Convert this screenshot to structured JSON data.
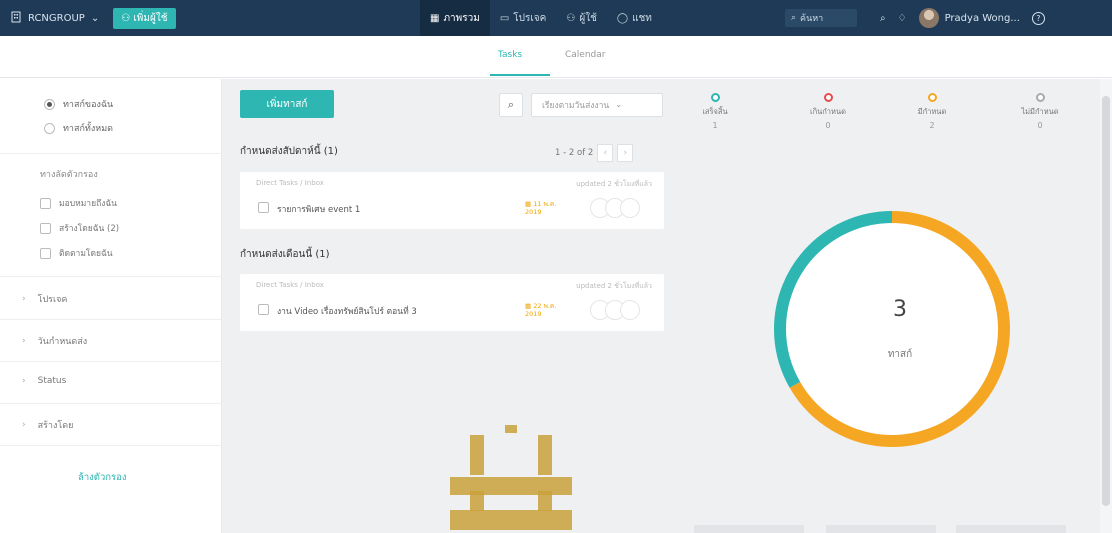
{
  "topbar": {
    "org_name": "RCNGROUP",
    "workspace": "เพิ่มผู้ใช้",
    "nav": [
      {
        "label": "ภาพรวม",
        "icon": "dashboard-icon",
        "active": true
      },
      {
        "label": "โปรเจค",
        "icon": "folder-icon",
        "active": false
      },
      {
        "label": "ผู้ใช้",
        "icon": "users-icon",
        "active": false
      },
      {
        "label": "แชท",
        "icon": "chat-icon",
        "active": false
      }
    ],
    "search_placeholder": "ค้นหา",
    "user_name": "Pradya Wong..."
  },
  "tabs": [
    {
      "label": "Tasks",
      "active": true
    },
    {
      "label": "Calendar",
      "active": false
    }
  ],
  "sidebar": {
    "view_options": [
      {
        "label": "ทาสก์ของฉัน",
        "selected": true
      },
      {
        "label": "ทาสก์ทั้งหมด",
        "selected": false
      }
    ],
    "filter_title": "ทางลัดตัวกรอง",
    "filters": [
      {
        "label": "มอบหมายถึงฉัน"
      },
      {
        "label": "สร้างโดยฉัน (2)"
      },
      {
        "label": "ติดตามโดยฉัน"
      }
    ],
    "sections": [
      "โปรเจค",
      "วันกำหนดส่ง",
      "Status",
      "สร้างโดย"
    ],
    "clear_label": "ล้างตัวกรอง"
  },
  "tasks": {
    "add_label": "เพิ่มทาสก์",
    "sort_label": "เรียงตามวันส่งงาน",
    "groups": [
      {
        "title": "กำหนดส่งสัปดาห์นี้ (1)",
        "pager": "1 - 2 of 2",
        "items": [
          {
            "crumb": "Direct Tasks / Inbox",
            "meta": "updated 2 ชั่วโมงที่แล้ว",
            "name": "รายการพิเศษ event 1",
            "due": "11 พ.ค. 2019"
          }
        ]
      },
      {
        "title": "กำหนดส่งเดือนนี้ (1)",
        "items": [
          {
            "crumb": "Direct Tasks / Inbox",
            "meta": "updated 2 ชั่วโมงที่แล้ว",
            "name": "งาน Video เรื่องทรัพย์สินโปร์ ตอนที่ 3",
            "due": "22 พ.ค. 2019"
          }
        ]
      }
    ]
  },
  "summary": {
    "stats": [
      {
        "label": "เสร็จสิ้น",
        "count": "1",
        "color": "#2db6b2"
      },
      {
        "label": "เกินกำหนด",
        "count": "0",
        "color": "#e74c4c"
      },
      {
        "label": "มีกำหนด",
        "count": "2",
        "color": "#f5a623"
      },
      {
        "label": "ไม่มีกำหนด",
        "count": "0",
        "color": "#aaaaaa"
      }
    ],
    "donut": {
      "total": "3",
      "label": "ทาสก์",
      "segments": [
        {
          "value": 1,
          "color": "#2db6b2"
        },
        {
          "value": 2,
          "color": "#f5a623"
        }
      ]
    }
  },
  "watermark": {
    "color": "#c9a13b"
  }
}
